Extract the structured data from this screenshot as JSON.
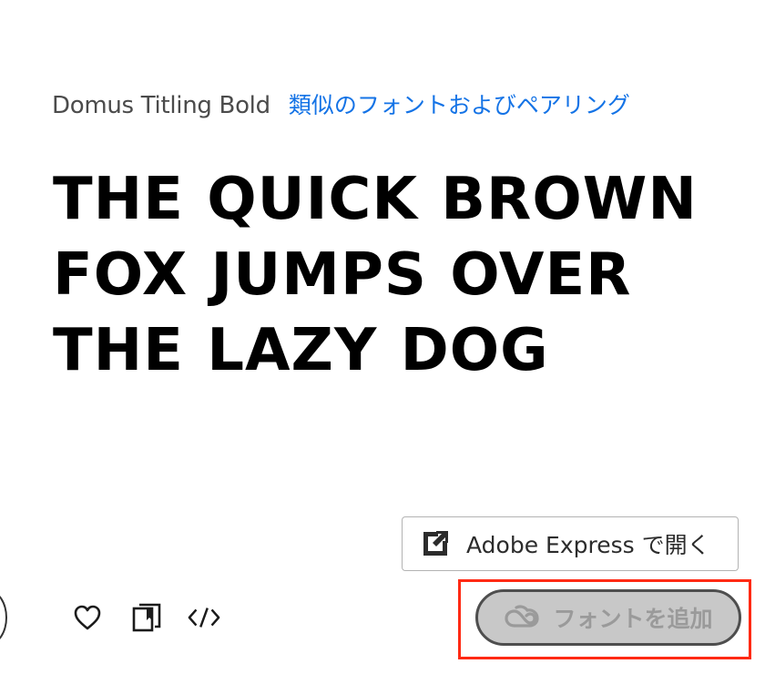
{
  "font": {
    "name": "Domus Titling Bold",
    "similar_link": "類似のフォントおよびペアリング"
  },
  "sample": {
    "text": "THE QUICK BROWN FOX JUMPS OVER THE LAZY DOG"
  },
  "actions": {
    "open_express_label": "Adobe Express で開く",
    "open_express_icon": "open-in-app-icon",
    "add_font_label": "フォントを追加",
    "add_font_icon": "creative-cloud-icon",
    "add_font_enabled": false,
    "favorite_icon": "heart-icon",
    "add_to_list_icon": "bookmark-list-icon",
    "embed_icon": "code-icon"
  },
  "colors": {
    "link": "#1473e6",
    "highlight": "#ff2a14",
    "disabled_button_bg": "#c8c8c8",
    "disabled_button_text": "#9a9a9a"
  }
}
